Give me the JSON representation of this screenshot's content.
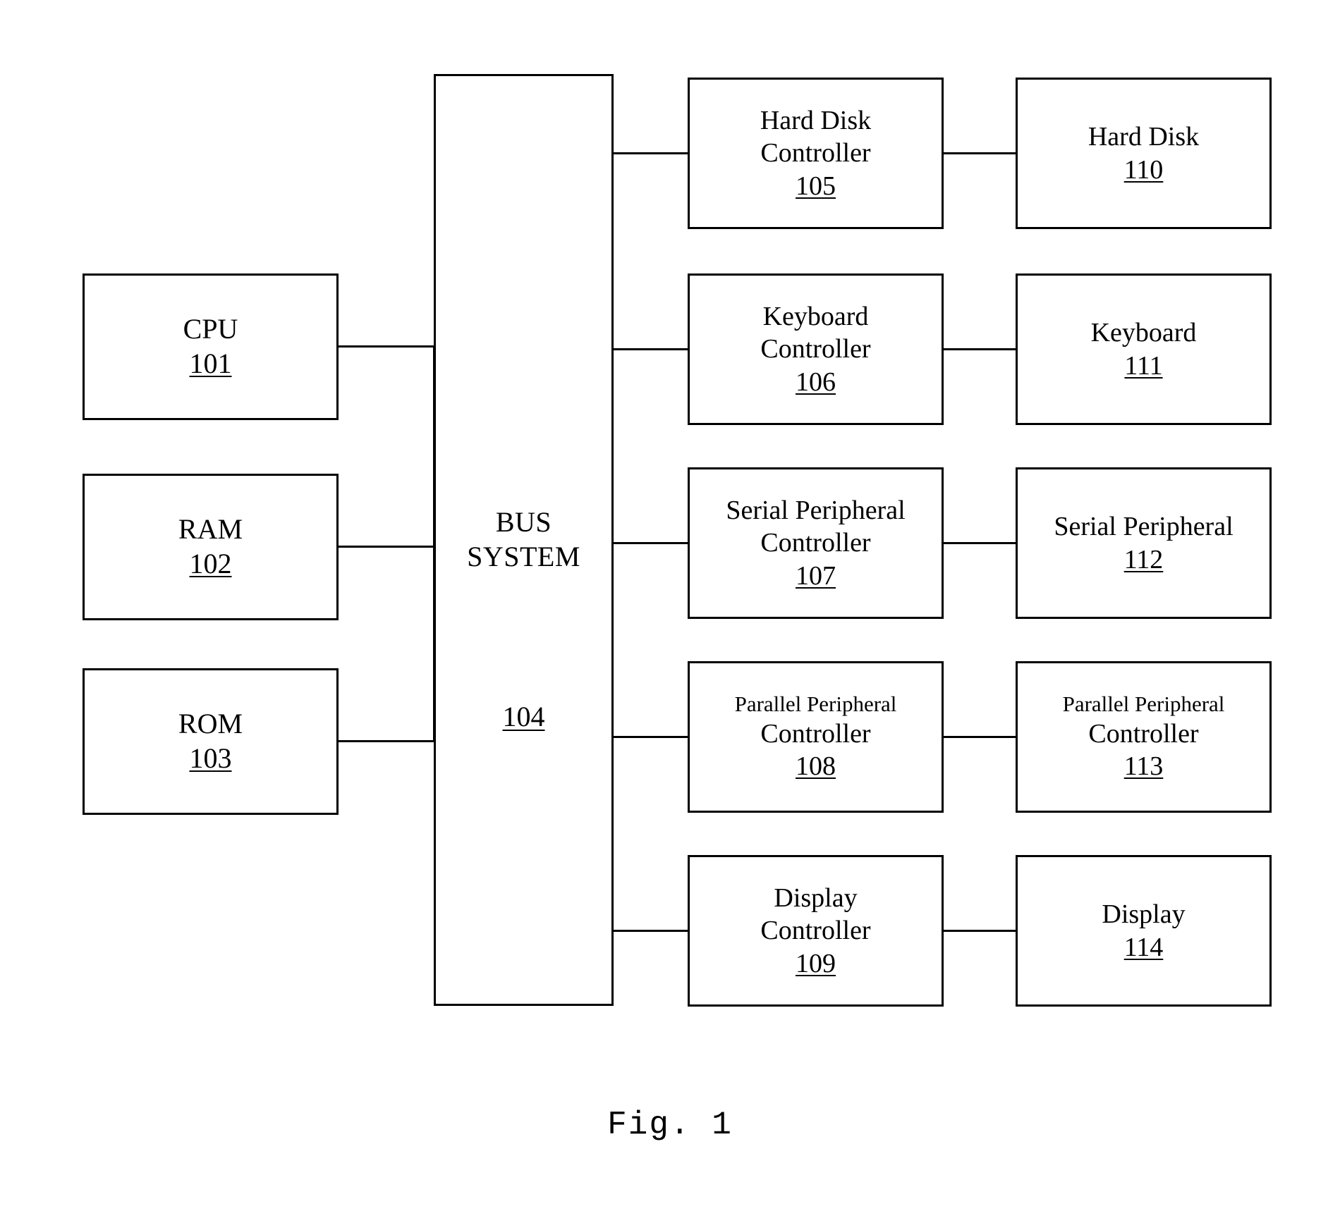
{
  "figure": {
    "caption": "Fig. 1",
    "bus": {
      "line1": "BUS",
      "line2": "SYSTEM",
      "ref": "104"
    },
    "left_column": [
      {
        "label": "CPU",
        "ref": "101"
      },
      {
        "label": "RAM",
        "ref": "102"
      },
      {
        "label": "ROM",
        "ref": "103"
      }
    ],
    "controller_column": [
      {
        "line1": "Hard Disk",
        "line2": "Controller",
        "ref": "105"
      },
      {
        "line1": "Keyboard",
        "line2": "Controller",
        "ref": "106"
      },
      {
        "line1": "Serial Peripheral",
        "line2": "Controller",
        "ref": "107"
      },
      {
        "line1": "Parallel Peripheral",
        "line2": "Controller",
        "ref": "108"
      },
      {
        "line1": "Display",
        "line2": "Controller",
        "ref": "109"
      }
    ],
    "peripheral_column": [
      {
        "line1": "Hard Disk",
        "line2": "",
        "ref": "110"
      },
      {
        "line1": "Keyboard",
        "line2": "",
        "ref": "111"
      },
      {
        "line1": "Serial Peripheral",
        "line2": "",
        "ref": "112"
      },
      {
        "line1": "Parallel Peripheral",
        "line2": "Controller",
        "ref": "113"
      },
      {
        "line1": "Display",
        "line2": "",
        "ref": "114"
      }
    ]
  }
}
